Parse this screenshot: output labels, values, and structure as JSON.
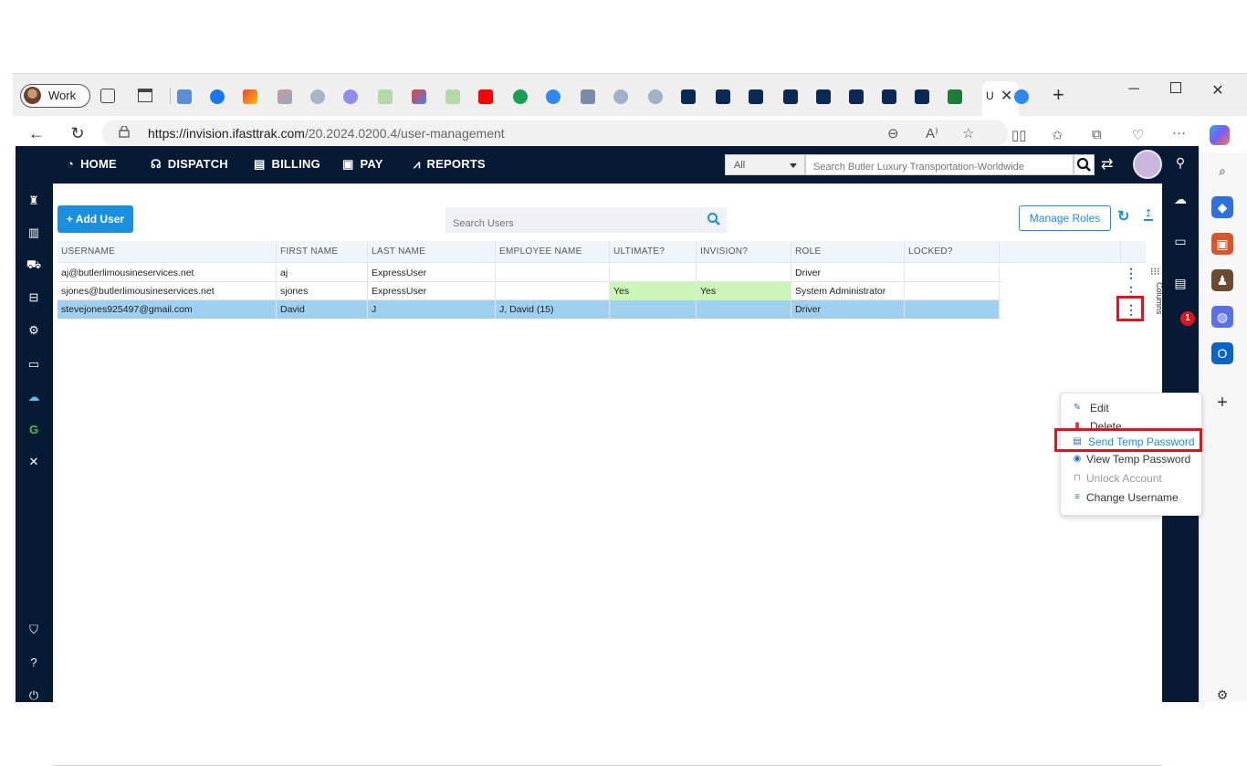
{
  "browser": {
    "profile_label": "Work",
    "active_tab_title": "U",
    "url_host": "https://invision.ifasttrak.com",
    "url_path": "/20.2024.0200.4/user-management"
  },
  "nav": {
    "home": "HOME",
    "dispatch": "DISPATCH",
    "billing": "BILLING",
    "pay": "PAY",
    "reports": "REPORTS",
    "search_scope": "All",
    "search_placeholder": "Search Butler Luxury Transportation-Worldwide"
  },
  "toolbar": {
    "add_user": "+ Add User",
    "search_placeholder": "Search Users",
    "manage_roles": "Manage Roles"
  },
  "grid": {
    "columns": [
      "USERNAME",
      "FIRST NAME",
      "LAST NAME",
      "EMPLOYEE NAME",
      "ULTIMATE?",
      "INVISION?",
      "ROLE",
      "LOCKED?"
    ],
    "rows": [
      {
        "username": "aj@butlerlimousineservices.net",
        "first": "aj",
        "last": "ExpressUser",
        "employee": "",
        "ultimate": "",
        "invision": "",
        "role": "Driver",
        "locked": ""
      },
      {
        "username": "sjones@butlerlimousineservices.net",
        "first": "sjones",
        "last": "ExpressUser",
        "employee": "",
        "ultimate": "Yes",
        "invision": "Yes",
        "role": "System Administrator",
        "locked": ""
      },
      {
        "username": "stevejones925497@gmail.com",
        "first": "David",
        "last": "J",
        "employee": "J, David (15)",
        "ultimate": "",
        "invision": "",
        "role": "Driver",
        "locked": ""
      }
    ],
    "selected_row": 2,
    "columns_tab": "Columns"
  },
  "menu": {
    "items": [
      "Edit",
      "Delete",
      "Send Temp Password",
      "View Temp Password",
      "Unlock Account",
      "Change Username"
    ],
    "active_item": "Send Temp Password",
    "disabled_item": "Unlock Account"
  },
  "notifications": {
    "count": "1"
  },
  "colors": {
    "nav_bg": "#061a33",
    "accent": "#1a8fe0",
    "selected_row": "#9fd0ef",
    "yes_cell": "#ccf5b8",
    "highlight": "#e0141e"
  }
}
